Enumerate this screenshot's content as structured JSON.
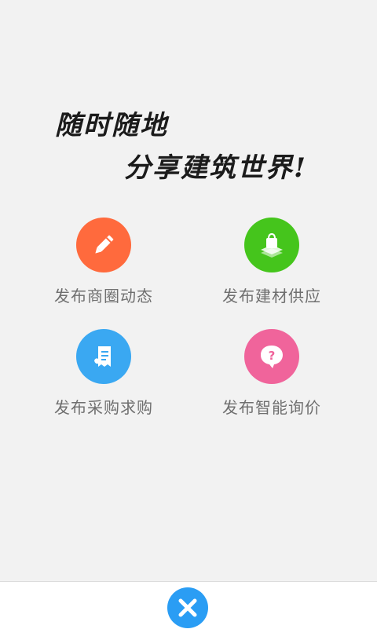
{
  "slogan": {
    "line1": "随时随地",
    "line2": "分享建筑世界!"
  },
  "actions": [
    {
      "label": "发布商圈动态",
      "icon": "pencil-icon",
      "color": "#ff6a3d"
    },
    {
      "label": "发布建材供应",
      "icon": "shopping-bag-icon",
      "color": "#45c51c"
    },
    {
      "label": "发布采购求购",
      "icon": "receipt-icon",
      "color": "#3aa8f2"
    },
    {
      "label": "发布智能询价",
      "icon": "question-bubble-icon",
      "color": "#f0649b"
    }
  ],
  "bottom_bar": {
    "close_icon": "close-icon",
    "close_color": "#2a9df4"
  }
}
